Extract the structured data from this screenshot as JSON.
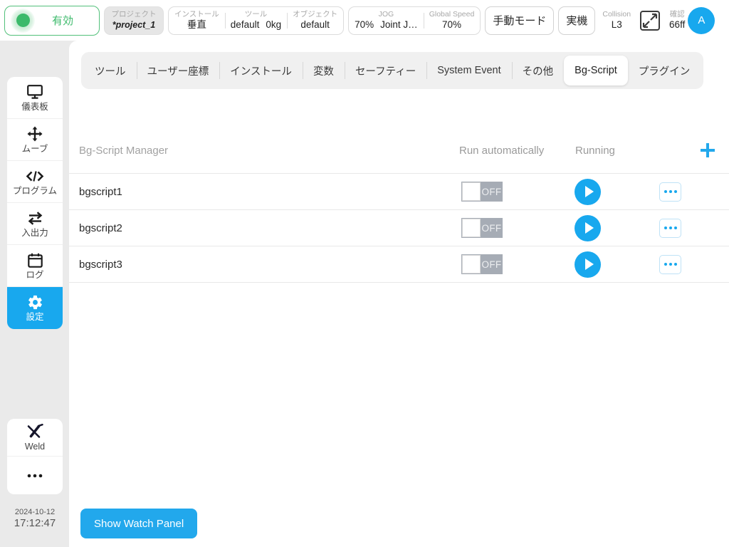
{
  "topbar": {
    "status": {
      "label": "有効",
      "color": "#3cba6b",
      "icon": "status-led-icon"
    },
    "project": {
      "caption": "プロジェクト",
      "value": "*project_1"
    },
    "install": {
      "caption": "インストール",
      "value": "垂直"
    },
    "tool": {
      "caption": "ツール",
      "value": "default",
      "payload": "0kg"
    },
    "object": {
      "caption": "オブジェクト",
      "value": "default"
    },
    "jog": {
      "caption": "JOG",
      "percent": "70%",
      "mode": "Joint J…"
    },
    "global_speed": {
      "caption": "Global Speed",
      "value": "70%"
    },
    "mode_button": "手動モード",
    "machine_button": "実機",
    "collision": {
      "caption": "Collision",
      "value": "L3"
    },
    "confirm": {
      "caption": "確認",
      "value": "66ff",
      "icon": "expand-icon"
    },
    "avatar": "A"
  },
  "sidebar": {
    "items": [
      {
        "label": "儀表板",
        "icon": "monitor-icon",
        "active": false
      },
      {
        "label": "ムーブ",
        "icon": "move-arrows-icon",
        "active": false
      },
      {
        "label": "プログラム",
        "icon": "code-icon",
        "active": false
      },
      {
        "label": "入出力",
        "icon": "io-exchange-icon",
        "active": false
      },
      {
        "label": "ログ",
        "icon": "calendar-icon",
        "active": false
      },
      {
        "label": "設定",
        "icon": "gear-icon",
        "active": true
      }
    ],
    "extras": [
      {
        "label": "Weld",
        "icon": "weld-torch-icon"
      },
      {
        "label": "",
        "icon": "ellipsis-icon"
      }
    ],
    "accent": "#18a8ee"
  },
  "clock": {
    "date": "2024-10-12",
    "time": "17:12:47"
  },
  "tabs": [
    {
      "label": "ツール",
      "active": false,
      "divider": false
    },
    {
      "label": "ユーザー座標",
      "active": false,
      "divider": true
    },
    {
      "label": "インストール",
      "active": false,
      "divider": true
    },
    {
      "label": "変数",
      "active": false,
      "divider": true
    },
    {
      "label": "セーフティー",
      "active": false,
      "divider": true
    },
    {
      "label": "System Event",
      "active": false,
      "divider": true
    },
    {
      "label": "その他",
      "active": false,
      "divider": true
    },
    {
      "label": "Bg-Script",
      "active": true,
      "divider": false
    },
    {
      "label": "プラグイン",
      "active": false,
      "divider": false
    }
  ],
  "list": {
    "title": "Bg-Script Manager",
    "col_auto": "Run automatically",
    "col_running": "Running",
    "add_icon": "plus-icon",
    "rows": [
      {
        "name": "bgscript1",
        "toggle_state": "OFF",
        "play_icon": "play-icon",
        "more_icon": "more-options-icon"
      },
      {
        "name": "bgscript2",
        "toggle_state": "OFF",
        "play_icon": "play-icon",
        "more_icon": "more-options-icon"
      },
      {
        "name": "bgscript3",
        "toggle_state": "OFF",
        "play_icon": "play-icon",
        "more_icon": "more-options-icon"
      }
    ]
  },
  "footer": {
    "watch_panel_button": "Show Watch Panel"
  }
}
